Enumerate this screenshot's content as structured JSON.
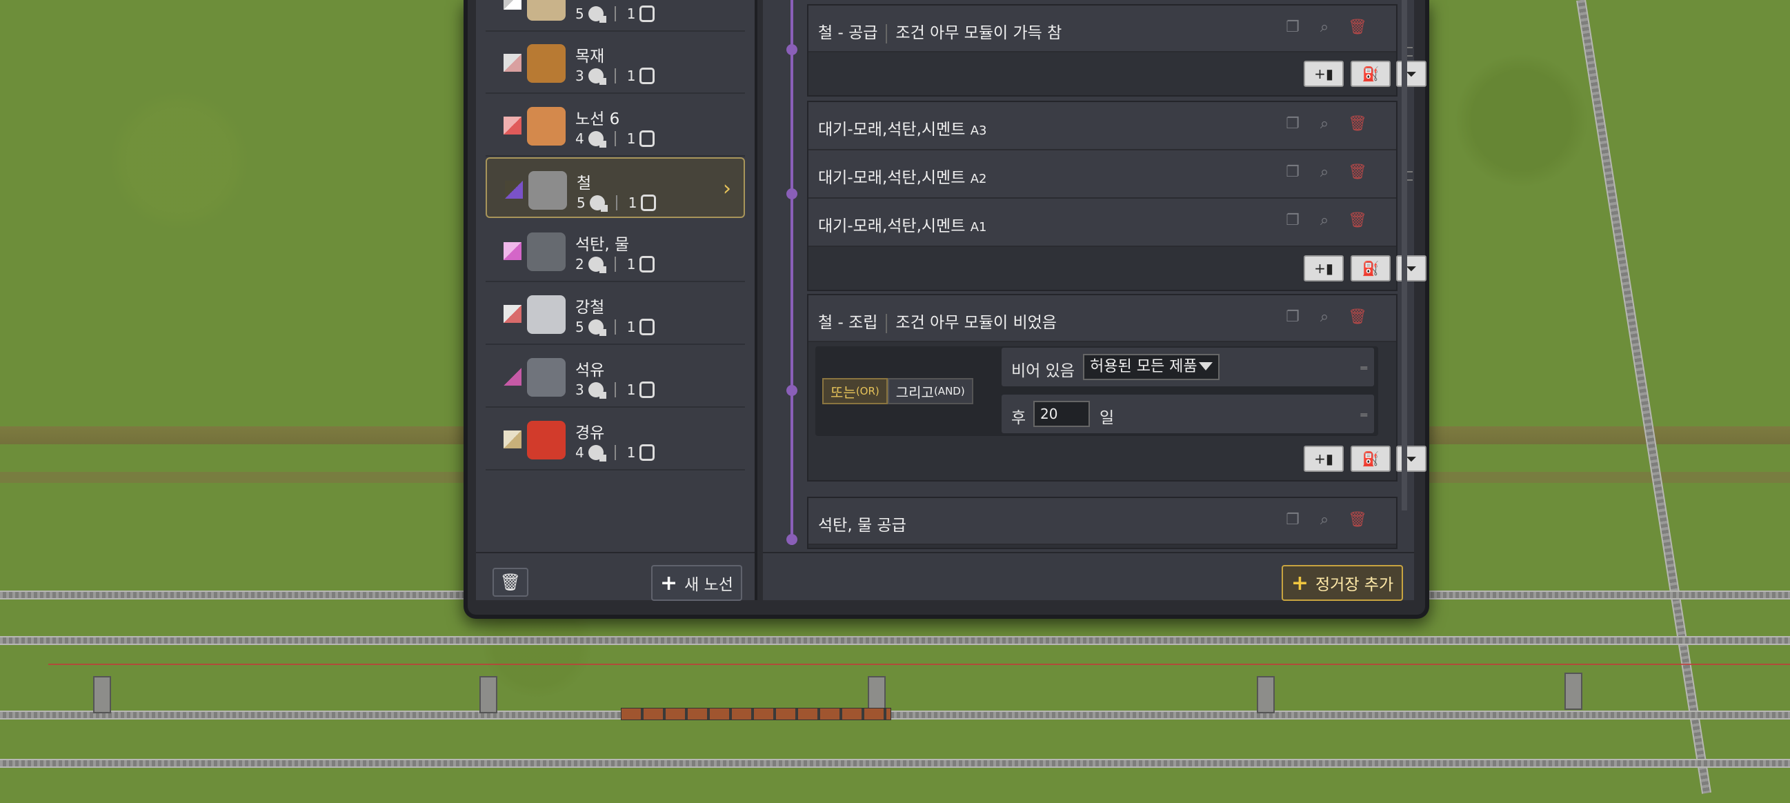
{
  "lines": [
    {
      "name": "",
      "stations": "5",
      "trains": "1",
      "swatch": "#ffffff",
      "swatch2": "#c8c8c8",
      "cargo_color": "#c9b38a",
      "selected": false
    },
    {
      "name": "목재",
      "stations": "3",
      "trains": "1",
      "swatch": "#d9a0a0",
      "swatch2": "#e0e0e0",
      "cargo_color": "#b87a33",
      "selected": false
    },
    {
      "name": "노선 6",
      "stations": "4",
      "trains": "1",
      "swatch": "#e05a5a",
      "swatch2": "#f0b0b0",
      "cargo_color": "#d4894c",
      "selected": false
    },
    {
      "name": "철",
      "stations": "5",
      "trains": "1",
      "swatch": "#7a52c8",
      "swatch2": "#4a4636",
      "cargo_color": "#8c8c8c",
      "selected": true
    },
    {
      "name": "석탄, 물",
      "stations": "2",
      "trains": "1",
      "swatch": "#d466c8",
      "swatch2": "#f0b8ea",
      "cargo_color": "#666a70",
      "selected": false
    },
    {
      "name": "강철",
      "stations": "5",
      "trains": "1",
      "swatch": "#d96b6b",
      "swatch2": "#e8e8e8",
      "cargo_color": "#c6c8cc",
      "selected": false
    },
    {
      "name": "석유",
      "stations": "3",
      "trains": "1",
      "swatch": "#c65aa6",
      "swatch2": "#3a3c44",
      "cargo_color": "#70747c",
      "selected": false
    },
    {
      "name": "경유",
      "stations": "4",
      "trains": "1",
      "swatch": "#c8b07a",
      "swatch2": "#e8e0c8",
      "cargo_color": "#d23b2b",
      "selected": false
    }
  ],
  "left_footer": {
    "new_line_label": "새 노선"
  },
  "stops": {
    "s1": {
      "name": "철 - 공급",
      "condition": "조건 아무 모듈이 가득 참"
    },
    "s2a": {
      "name": "대기-모래,석탄,시멘트",
      "suffix": "A3"
    },
    "s2b": {
      "name": "대기-모래,석탄,시멘트",
      "suffix": "A2"
    },
    "s2c": {
      "name": "대기-모래,석탄,시멘트",
      "suffix": "A1"
    },
    "s3": {
      "name": "철 - 조립",
      "condition": "조건 아무 모듈이 비었음"
    },
    "s4": {
      "name": "석탄, 물 공급"
    }
  },
  "condition": {
    "or_label": "또는",
    "or_small": "(OR)",
    "and_label": "그리고",
    "and_small": "(AND)",
    "row1_label": "비어 있음",
    "row1_select": "허용된 모든 제품",
    "row2_label": "후",
    "row2_value": "20",
    "row2_unit": "일"
  },
  "right_footer": {
    "add_stop_label": "정거장 추가"
  },
  "colors": {
    "accent_gold": "#e6c35a",
    "timeline": "#8a5fb8",
    "delete": "#b24848"
  }
}
